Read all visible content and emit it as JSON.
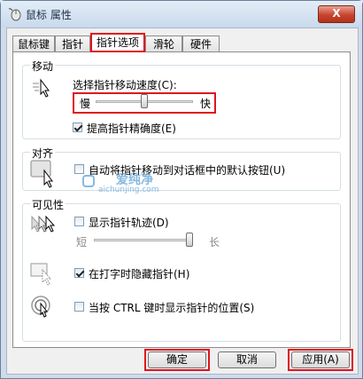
{
  "window": {
    "title": "鼠标 属性",
    "close_label": "X"
  },
  "tabs": [
    {
      "label": "鼠标键"
    },
    {
      "label": "指针"
    },
    {
      "label": "指针选项"
    },
    {
      "label": "滑轮"
    },
    {
      "label": "硬件"
    }
  ],
  "motion": {
    "title": "移动",
    "speed_label": "选择指针移动速度(C):",
    "slow": "慢",
    "fast": "快",
    "speed_level": 0.5,
    "precision_label": "提高指针精确度(E)",
    "precision_checked": true
  },
  "snap": {
    "title": "对齐",
    "label": "自动将指针移动到对话框中的默认按钮(U)",
    "checked": false
  },
  "visibility": {
    "title": "可见性",
    "trails_label": "显示指针轨迹(D)",
    "trails_checked": false,
    "short": "短",
    "long": "长",
    "trail_level": 1.0,
    "hide_label": "在打字时隐藏指针(H)",
    "hide_checked": true,
    "ctrl_label": "当按 CTRL 键时显示指针的位置(S)",
    "ctrl_checked": false
  },
  "watermark": {
    "logo_text": "爱纯净",
    "url": "aichunjing.com"
  },
  "buttons": {
    "ok": "确定",
    "cancel": "取消",
    "apply": "应用(A)"
  },
  "colors": {
    "highlight": "#e0141e",
    "title_bar": "#c9d9ec"
  }
}
